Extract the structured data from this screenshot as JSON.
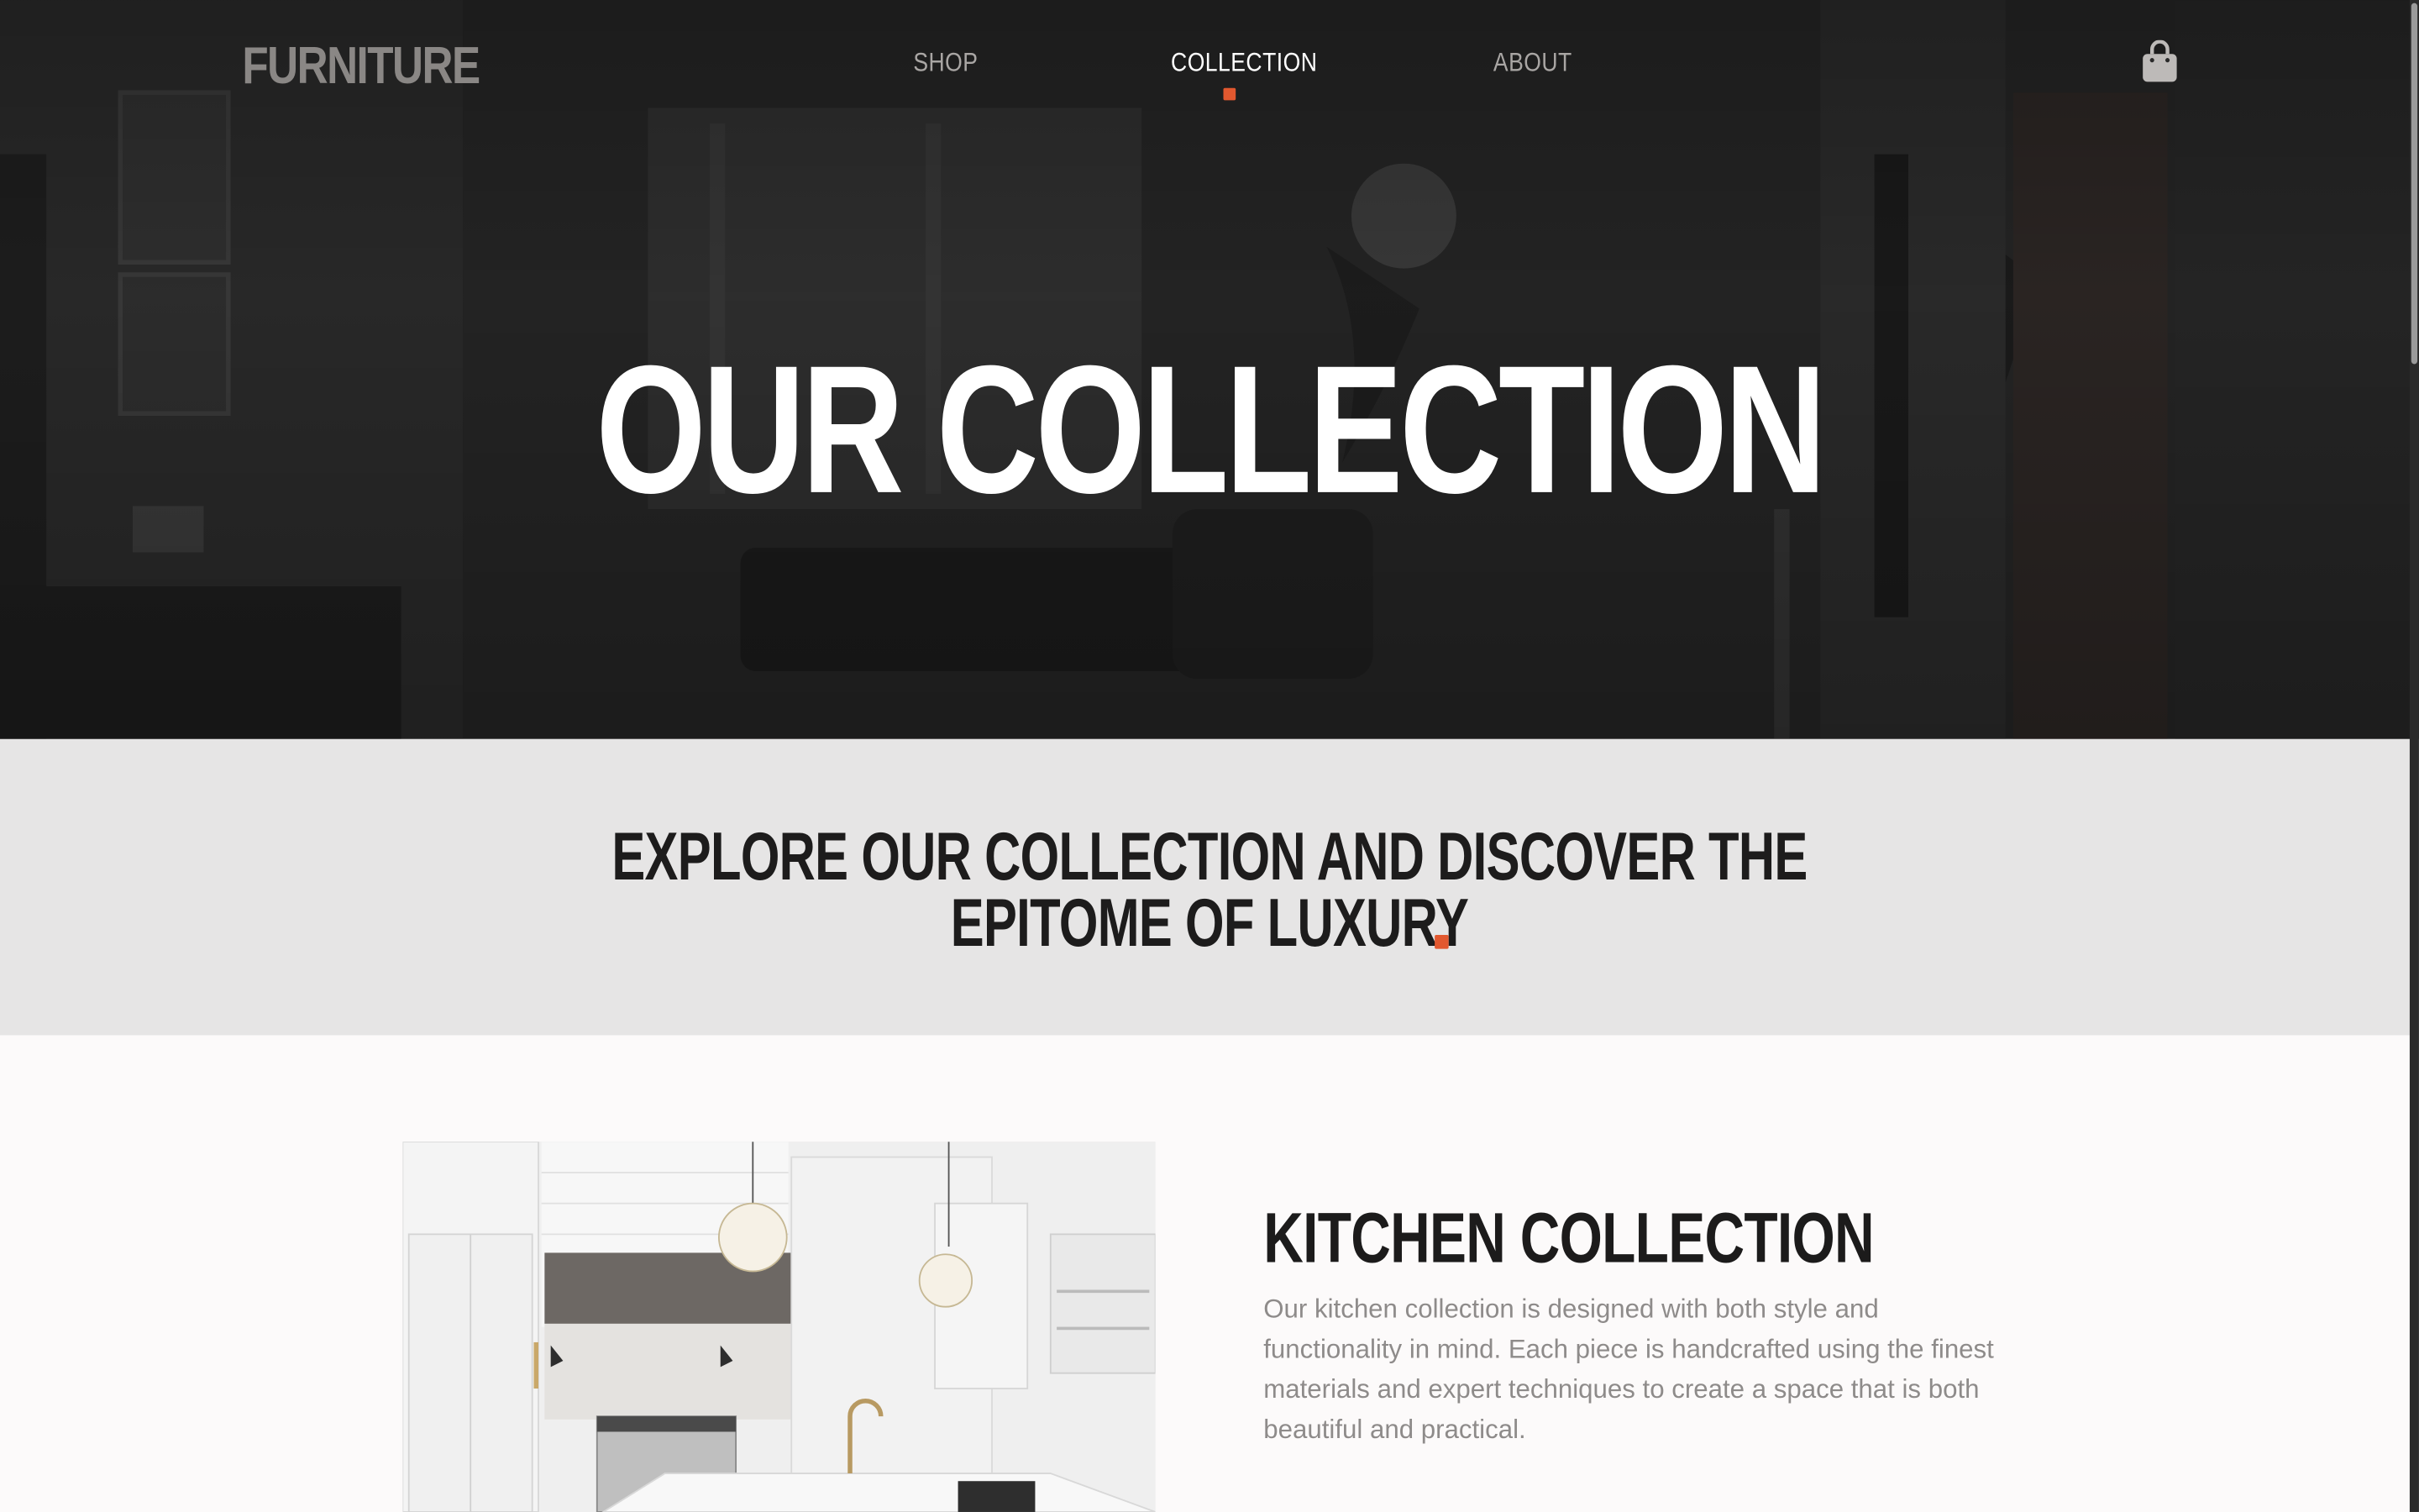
{
  "nav": {
    "logo": "FURNITURE",
    "items": [
      {
        "label": "SHOP"
      },
      {
        "label": "COLLECTION"
      },
      {
        "label": "ABOUT"
      }
    ],
    "active_index": 1,
    "cart_icon": "shopping-bag-icon"
  },
  "hero": {
    "title": "OUR COLLECTION"
  },
  "explore": {
    "line1": "EXPLORE OUR COLLECTION AND DISCOVER THE",
    "line2": "EPITOME OF LUXURY"
  },
  "kitchen": {
    "title": "KITCHEN COLLECTION",
    "body": "Our kitchen collection is designed with both style and functionality in mind. Each piece is handcrafted using the finest materials and expert techniques to create a space that is both beautiful and practical."
  },
  "colors": {
    "accent": "#e2582f",
    "hero_text": "#ffffff",
    "band_bg": "#e6e5e5",
    "dark_text": "#1d1c1c",
    "muted_text": "#8e8b8a"
  }
}
